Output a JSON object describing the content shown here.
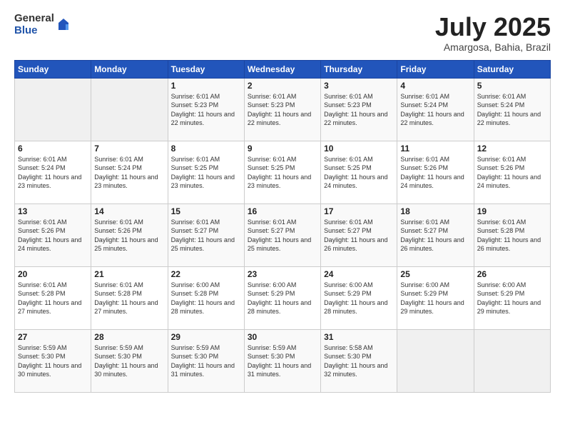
{
  "logo": {
    "general": "General",
    "blue": "Blue"
  },
  "title": "July 2025",
  "subtitle": "Amargosa, Bahia, Brazil",
  "headers": [
    "Sunday",
    "Monday",
    "Tuesday",
    "Wednesday",
    "Thursday",
    "Friday",
    "Saturday"
  ],
  "weeks": [
    [
      {
        "day": "",
        "info": ""
      },
      {
        "day": "",
        "info": ""
      },
      {
        "day": "1",
        "info": "Sunrise: 6:01 AM\nSunset: 5:23 PM\nDaylight: 11 hours and 22 minutes."
      },
      {
        "day": "2",
        "info": "Sunrise: 6:01 AM\nSunset: 5:23 PM\nDaylight: 11 hours and 22 minutes."
      },
      {
        "day": "3",
        "info": "Sunrise: 6:01 AM\nSunset: 5:23 PM\nDaylight: 11 hours and 22 minutes."
      },
      {
        "day": "4",
        "info": "Sunrise: 6:01 AM\nSunset: 5:24 PM\nDaylight: 11 hours and 22 minutes."
      },
      {
        "day": "5",
        "info": "Sunrise: 6:01 AM\nSunset: 5:24 PM\nDaylight: 11 hours and 22 minutes."
      }
    ],
    [
      {
        "day": "6",
        "info": "Sunrise: 6:01 AM\nSunset: 5:24 PM\nDaylight: 11 hours and 23 minutes."
      },
      {
        "day": "7",
        "info": "Sunrise: 6:01 AM\nSunset: 5:24 PM\nDaylight: 11 hours and 23 minutes."
      },
      {
        "day": "8",
        "info": "Sunrise: 6:01 AM\nSunset: 5:25 PM\nDaylight: 11 hours and 23 minutes."
      },
      {
        "day": "9",
        "info": "Sunrise: 6:01 AM\nSunset: 5:25 PM\nDaylight: 11 hours and 23 minutes."
      },
      {
        "day": "10",
        "info": "Sunrise: 6:01 AM\nSunset: 5:25 PM\nDaylight: 11 hours and 24 minutes."
      },
      {
        "day": "11",
        "info": "Sunrise: 6:01 AM\nSunset: 5:26 PM\nDaylight: 11 hours and 24 minutes."
      },
      {
        "day": "12",
        "info": "Sunrise: 6:01 AM\nSunset: 5:26 PM\nDaylight: 11 hours and 24 minutes."
      }
    ],
    [
      {
        "day": "13",
        "info": "Sunrise: 6:01 AM\nSunset: 5:26 PM\nDaylight: 11 hours and 24 minutes."
      },
      {
        "day": "14",
        "info": "Sunrise: 6:01 AM\nSunset: 5:26 PM\nDaylight: 11 hours and 25 minutes."
      },
      {
        "day": "15",
        "info": "Sunrise: 6:01 AM\nSunset: 5:27 PM\nDaylight: 11 hours and 25 minutes."
      },
      {
        "day": "16",
        "info": "Sunrise: 6:01 AM\nSunset: 5:27 PM\nDaylight: 11 hours and 25 minutes."
      },
      {
        "day": "17",
        "info": "Sunrise: 6:01 AM\nSunset: 5:27 PM\nDaylight: 11 hours and 26 minutes."
      },
      {
        "day": "18",
        "info": "Sunrise: 6:01 AM\nSunset: 5:27 PM\nDaylight: 11 hours and 26 minutes."
      },
      {
        "day": "19",
        "info": "Sunrise: 6:01 AM\nSunset: 5:28 PM\nDaylight: 11 hours and 26 minutes."
      }
    ],
    [
      {
        "day": "20",
        "info": "Sunrise: 6:01 AM\nSunset: 5:28 PM\nDaylight: 11 hours and 27 minutes."
      },
      {
        "day": "21",
        "info": "Sunrise: 6:01 AM\nSunset: 5:28 PM\nDaylight: 11 hours and 27 minutes."
      },
      {
        "day": "22",
        "info": "Sunrise: 6:00 AM\nSunset: 5:28 PM\nDaylight: 11 hours and 28 minutes."
      },
      {
        "day": "23",
        "info": "Sunrise: 6:00 AM\nSunset: 5:29 PM\nDaylight: 11 hours and 28 minutes."
      },
      {
        "day": "24",
        "info": "Sunrise: 6:00 AM\nSunset: 5:29 PM\nDaylight: 11 hours and 28 minutes."
      },
      {
        "day": "25",
        "info": "Sunrise: 6:00 AM\nSunset: 5:29 PM\nDaylight: 11 hours and 29 minutes."
      },
      {
        "day": "26",
        "info": "Sunrise: 6:00 AM\nSunset: 5:29 PM\nDaylight: 11 hours and 29 minutes."
      }
    ],
    [
      {
        "day": "27",
        "info": "Sunrise: 5:59 AM\nSunset: 5:30 PM\nDaylight: 11 hours and 30 minutes."
      },
      {
        "day": "28",
        "info": "Sunrise: 5:59 AM\nSunset: 5:30 PM\nDaylight: 11 hours and 30 minutes."
      },
      {
        "day": "29",
        "info": "Sunrise: 5:59 AM\nSunset: 5:30 PM\nDaylight: 11 hours and 31 minutes."
      },
      {
        "day": "30",
        "info": "Sunrise: 5:59 AM\nSunset: 5:30 PM\nDaylight: 11 hours and 31 minutes."
      },
      {
        "day": "31",
        "info": "Sunrise: 5:58 AM\nSunset: 5:30 PM\nDaylight: 11 hours and 32 minutes."
      },
      {
        "day": "",
        "info": ""
      },
      {
        "day": "",
        "info": ""
      }
    ]
  ]
}
